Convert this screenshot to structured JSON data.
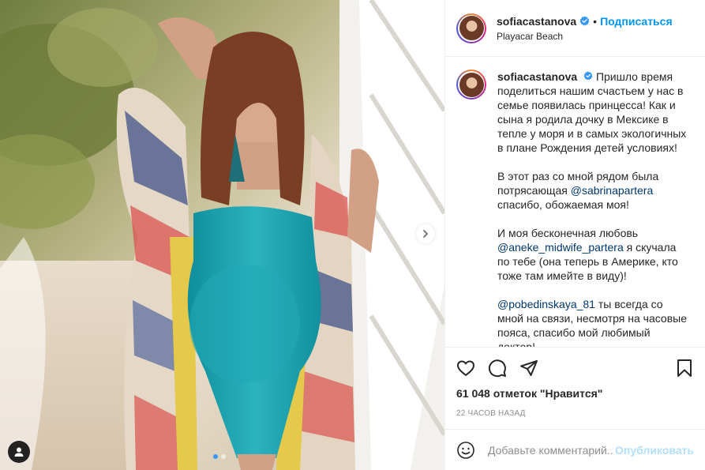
{
  "header": {
    "username": "sofiacastanova",
    "separator": "•",
    "follow_label": "Подписаться",
    "location": "Playacar Beach"
  },
  "caption": {
    "username": "sofiacastanova",
    "paragraph1": "Пришло время поделиться нашим счастьем у нас в семье появилась принцесса! Как и сына я родила дочку в Мексике в тепле у моря и в самых экологичных в плане Рождения детей условиях!",
    "p2_before": "В этот раз со мной рядом была потрясающая ",
    "p2_mention": "@sabrinapartera",
    "p2_after": " спасибо, обожаемая моя!",
    "p3_before": "И моя бесконечная любовь ",
    "p3_mention": "@aneke_midwife_partera",
    "p3_after": " я скучала по тебе (она теперь в Америке, кто тоже там имейте в виду)!",
    "p4_mention": "@pobedinskaya_81",
    "p4_after": " ты всегда со мной на связи, несмотря на часовые пояса, спасибо мой любимый доктор!"
  },
  "actions": {
    "likes": "61 048 отметок \"Нравится\"",
    "time": "22 часов назад"
  },
  "comment_box": {
    "placeholder": "Добавьте комментарий...",
    "post_label": "Опубликовать"
  },
  "icons": {
    "verified": "verified-badge-icon",
    "like": "heart-icon",
    "comment": "comment-bubble-icon",
    "share": "paper-plane-icon",
    "save": "bookmark-icon",
    "emoji": "smiley-icon",
    "next": "chevron-right-icon",
    "tag": "user-tag-icon"
  },
  "colors": {
    "accent": "#0095f6",
    "post_disabled": "#b2dffc",
    "mention": "#00376b",
    "swimsuit": "#1fa7b4"
  },
  "carousel": {
    "current": 1,
    "total": 2
  }
}
